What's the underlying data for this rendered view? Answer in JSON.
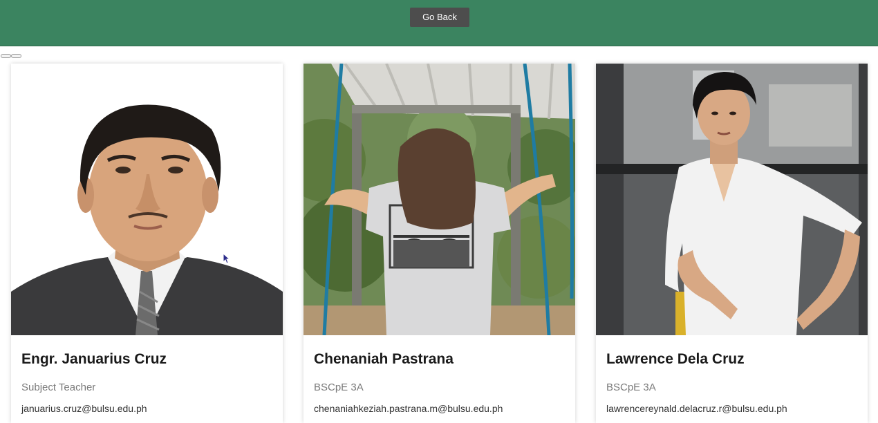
{
  "header": {
    "go_back_label": "Go Back",
    "background_color": "#3b8460"
  },
  "cards": [
    {
      "name": "Engr. Januarius Cruz",
      "role": "Subject Teacher",
      "email": "januarius.cruz@bulsu.edu.ph"
    },
    {
      "name": "Chenaniah Pastrana",
      "role": "BSCpE 3A",
      "email": "chenaniahkeziah.pastrana.m@bulsu.edu.ph"
    },
    {
      "name": "Lawrence Dela Cruz",
      "role": "BSCpE 3A",
      "email": "lawrencereynald.delacruz.r@bulsu.edu.ph"
    }
  ]
}
